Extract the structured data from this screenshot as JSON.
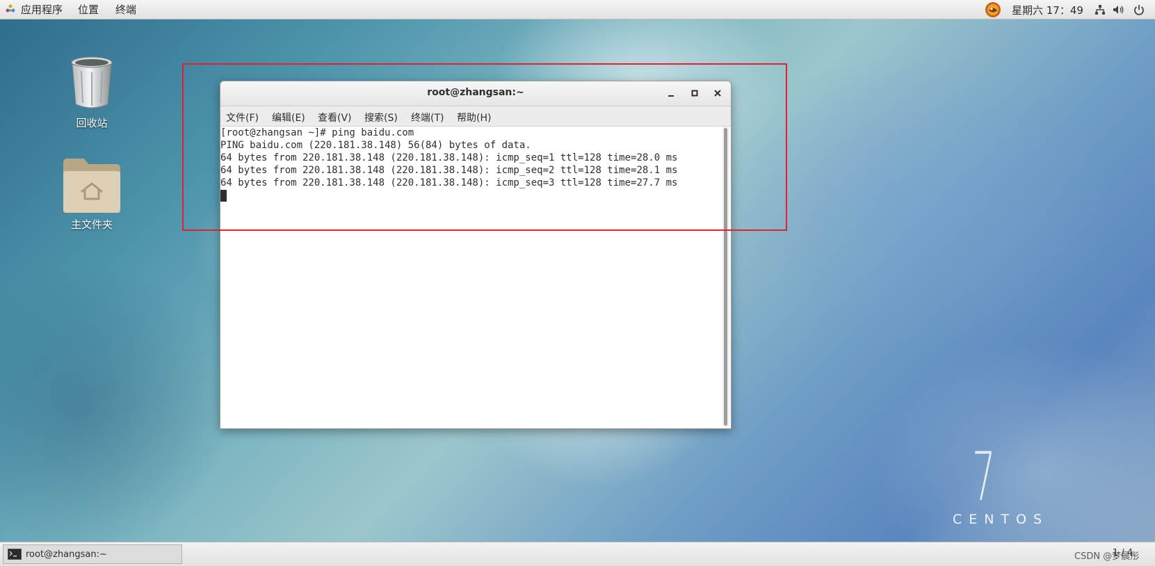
{
  "topbar": {
    "apps_menu": "应用程序",
    "places_menu": "位置",
    "terminal_menu": "终端",
    "clock": "星期六 17：49"
  },
  "desktop": {
    "trash_label": "回收站",
    "home_label": "主文件夹"
  },
  "window": {
    "title": "root@zhangsan:~",
    "menus": [
      "文件(F)",
      "编辑(E)",
      "查看(V)",
      "搜索(S)",
      "终端(T)",
      "帮助(H)"
    ],
    "lines": [
      "[root@zhangsan ~]# ping baidu.com",
      "PING baidu.com (220.181.38.148) 56(84) bytes of data.",
      "64 bytes from 220.181.38.148 (220.181.38.148): icmp_seq=1 ttl=128 time=28.0 ms",
      "64 bytes from 220.181.38.148 (220.181.38.148): icmp_seq=2 ttl=128 time=28.1 ms",
      "64 bytes from 220.181.38.148 (220.181.38.148): icmp_seq=3 ttl=128 time=27.7 ms"
    ]
  },
  "taskbar": {
    "item_label": "root@zhangsan:~",
    "watermark": "CSDN @梦晨彤",
    "pager": "1 / 4"
  },
  "branding": {
    "version": "7",
    "name": "CENTOS"
  },
  "colors": {
    "highlight_box": "#e0212e"
  }
}
